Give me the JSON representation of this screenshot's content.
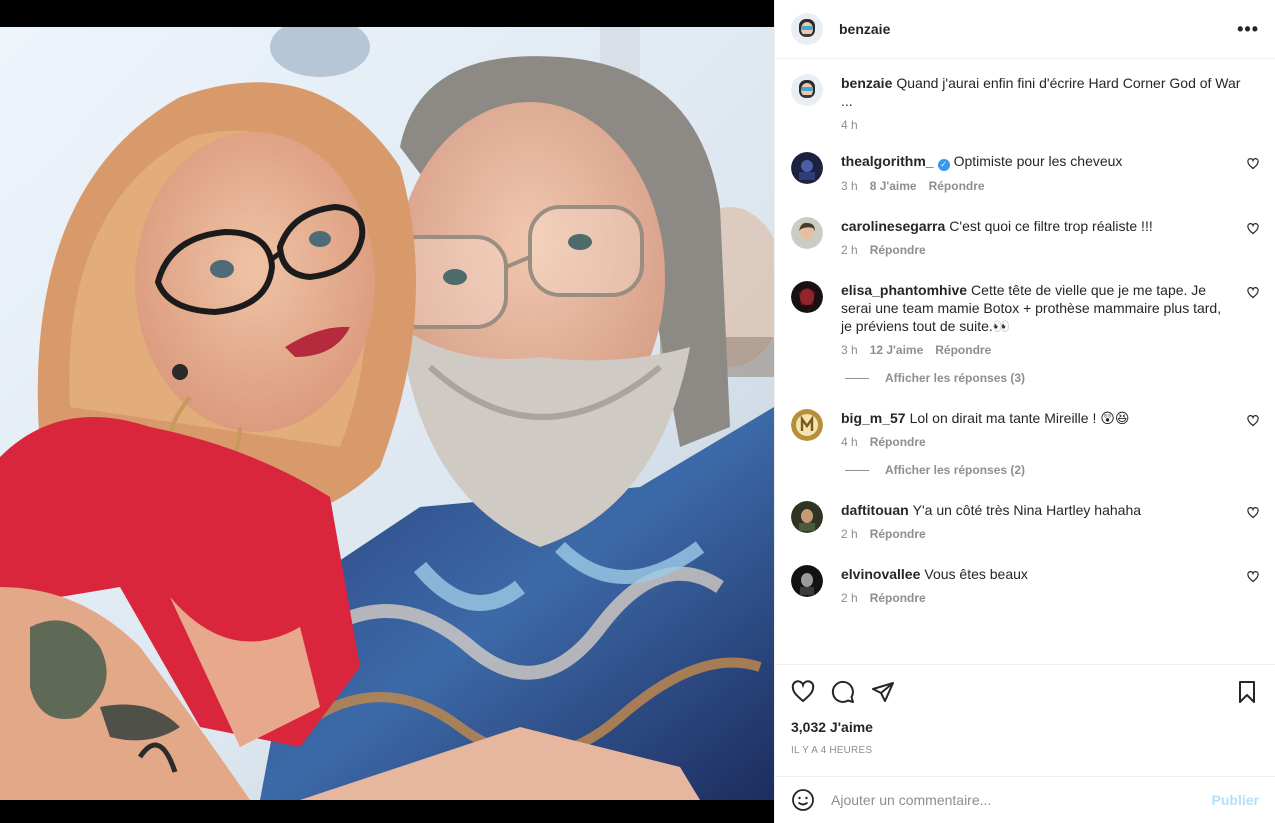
{
  "post": {
    "author": "benzaie",
    "more_label": "•••"
  },
  "caption": {
    "user": "benzaie",
    "text": "Quand j'aurai enfin fini d'écrire Hard Corner God of War ...",
    "time": "4 h"
  },
  "comments": [
    {
      "user": "thealgorithm_",
      "verified": true,
      "text": "Optimiste pour les cheveux",
      "time": "3 h",
      "likes": "8 J'aime",
      "reply": "Répondre"
    },
    {
      "user": "carolinesegarra",
      "text": "C'est quoi ce filtre trop réaliste !!!",
      "time": "2 h",
      "reply": "Répondre"
    },
    {
      "user": "elisa_phantomhive",
      "text": "Cette tête de vielle que je me tape. Je serai une team mamie Botox + prothèse mammaire plus tard, je préviens tout de suite.👀",
      "time": "3 h",
      "likes": "12 J'aime",
      "reply": "Répondre",
      "view_replies": "Afficher les réponses (3)"
    },
    {
      "user": "big_m_57",
      "text": "Lol on dirait ma tante Mireille ! 😲😆",
      "time": "4 h",
      "reply": "Répondre",
      "view_replies": "Afficher les réponses (2)"
    },
    {
      "user": "daftitouan",
      "text": "Y'a un côté très Nina Hartley hahaha",
      "time": "2 h",
      "reply": "Répondre"
    },
    {
      "user": "elvinovallee",
      "text": "Vous êtes beaux",
      "time": "2 h",
      "reply": "Répondre"
    }
  ],
  "stats": {
    "likes": "3,032 J'aime",
    "time_ago": "IL Y A 4 HEURES"
  },
  "composer": {
    "placeholder": "Ajouter un commentaire...",
    "publish": "Publier"
  },
  "colors": {
    "link": "#3897f0",
    "publish_disabled": "#b2dffc",
    "muted": "#8e8e8e"
  }
}
